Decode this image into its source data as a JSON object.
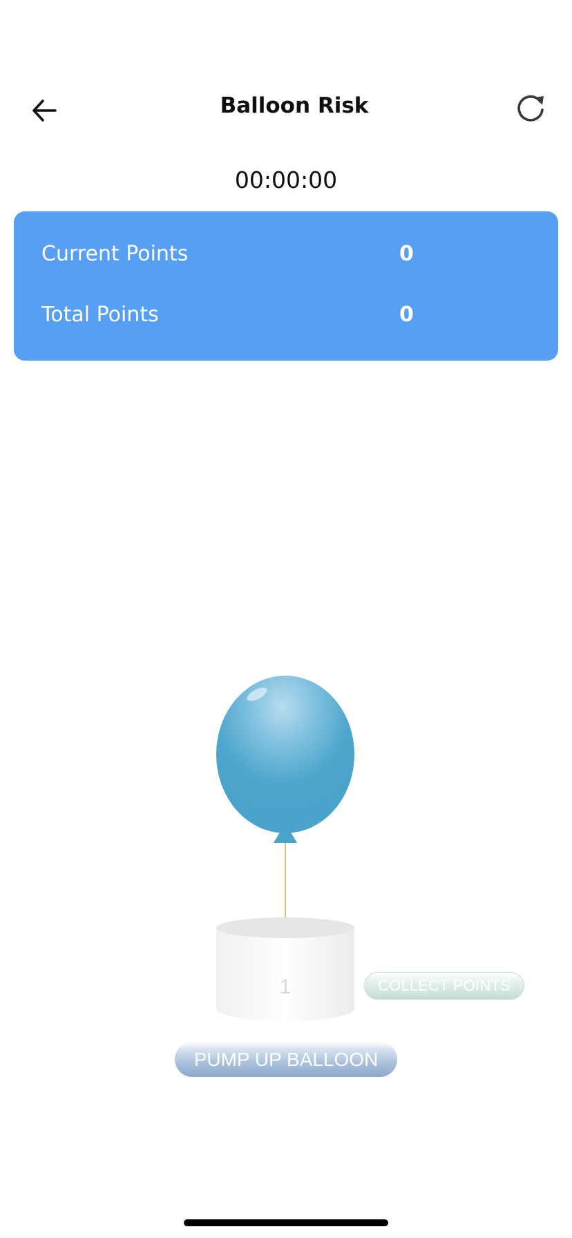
{
  "header": {
    "title": "Balloon Risk",
    "back_icon": "arrow-left-icon",
    "refresh_icon": "refresh-icon"
  },
  "timer": "00:00:00",
  "score": {
    "current_label": "Current Points",
    "current_value": "0",
    "total_label": "Total Points",
    "total_value": "0",
    "card_color": "#579ef5"
  },
  "game": {
    "pedestal_number": "1",
    "collect_label": "COLLECT POINTS",
    "pump_label": "PUMP UP BALLOON",
    "balloon_color": "#4da6cc"
  }
}
